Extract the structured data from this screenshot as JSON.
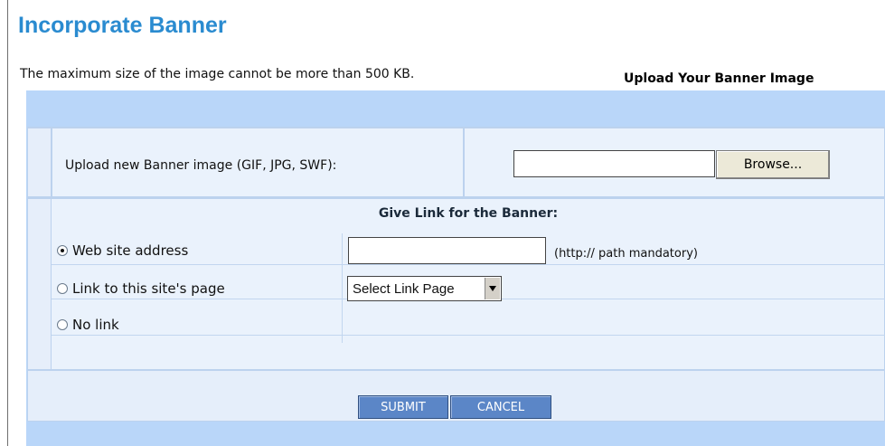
{
  "page": {
    "title": "Incorporate Banner",
    "intro": "The maximum size of the image cannot be more than 500 KB.",
    "upload_heading": "Upload Your Banner Image"
  },
  "upload": {
    "label": "Upload new Banner image (GIF, JPG, SWF):",
    "file_value": "",
    "browse_label": "Browse..."
  },
  "link": {
    "heading": "Give Link for the Banner:",
    "options": [
      {
        "label": "Web site address",
        "checked": true
      },
      {
        "label": "Link to this site's page",
        "checked": false
      },
      {
        "label": "No link",
        "checked": false
      }
    ],
    "url_value": "",
    "url_hint": "(http:// path mandatory)",
    "select_value": "Select Link Page"
  },
  "actions": {
    "submit_label": "SUBMIT",
    "cancel_label": "CANCEL"
  },
  "colors": {
    "title": "#2a8bd0",
    "panel": "#b9d6f9",
    "button": "#5b86c7"
  }
}
